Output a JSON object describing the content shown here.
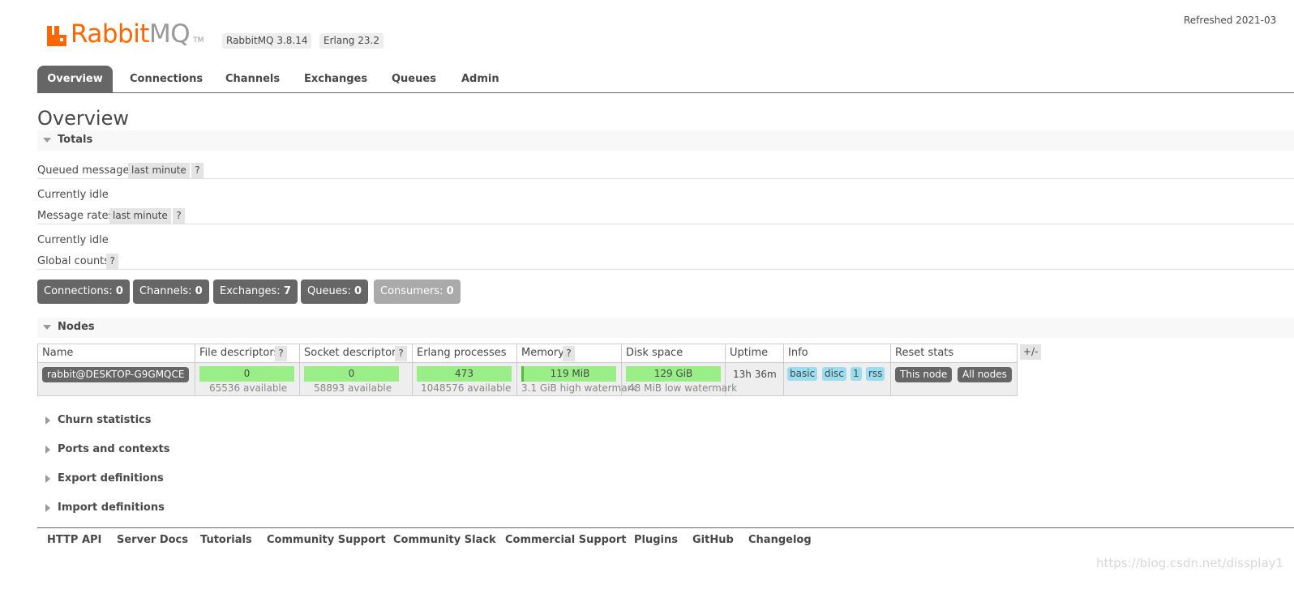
{
  "header": {
    "brand_rabbit": "Rabbit",
    "brand_mq": "MQ",
    "brand_tm": "TM",
    "rabbitmq_version": "RabbitMQ 3.8.14",
    "erlang_version": "Erlang 23.2",
    "refreshed": "Refreshed 2021-03",
    "brand_color": "#ff6600"
  },
  "tabs": [
    {
      "label": "Overview",
      "active": true
    },
    {
      "label": "Connections"
    },
    {
      "label": "Channels"
    },
    {
      "label": "Exchanges"
    },
    {
      "label": "Queues"
    },
    {
      "label": "Admin"
    }
  ],
  "page_title": "Overview",
  "totals": {
    "title": "Totals",
    "queued_messages_label": "Queued messages",
    "queued_messages_range": "last minute",
    "help": "?",
    "queued_idle": "Currently idle",
    "message_rates_label": "Message rates",
    "message_rates_range": "last minute",
    "rates_idle": "Currently idle",
    "global_counts_label": "Global counts"
  },
  "counts": {
    "connections_label": "Connections:",
    "connections_value": "0",
    "channels_label": "Channels:",
    "channels_value": "0",
    "exchanges_label": "Exchanges:",
    "exchanges_value": "7",
    "queues_label": "Queues:",
    "queues_value": "0",
    "consumers_label": "Consumers:",
    "consumers_value": "0"
  },
  "nodes": {
    "title": "Nodes",
    "columns": {
      "name": "Name",
      "file_descriptors": "File descriptors",
      "socket_descriptors": "Socket descriptors",
      "erlang_processes": "Erlang processes",
      "memory": "Memory",
      "disk_space": "Disk space",
      "uptime": "Uptime",
      "info": "Info",
      "reset_stats": "Reset stats"
    },
    "help": "?",
    "plus_minus": "+/-",
    "row": {
      "name": "rabbit@DESKTOP-G9GMQCE",
      "file_descriptors": "0",
      "file_descriptors_available": "65536 available",
      "socket_descriptors": "0",
      "socket_descriptors_available": "58893 available",
      "erlang_processes": "473",
      "erlang_processes_available": "1048576 available",
      "memory": "119 MiB",
      "memory_watermark": "3.1 GiB high watermark",
      "disk_space": "129 GiB",
      "disk_watermark": "48 MiB low watermark",
      "uptime": "13h 36m",
      "info_tags": [
        "basic",
        "disc",
        "1",
        "rss"
      ],
      "reset_this_node": "This node",
      "reset_all_nodes": "All nodes"
    }
  },
  "sections": {
    "churn": "Churn statistics",
    "ports": "Ports and contexts",
    "export": "Export definitions",
    "import": "Import definitions"
  },
  "footer": {
    "links": [
      "HTTP API",
      "Server Docs",
      "Tutorials",
      "Community Support",
      "Community Slack",
      "Commercial Support",
      "Plugins",
      "GitHub",
      "Changelog"
    ]
  },
  "watermark": "https://blog.csdn.net/dissplay1"
}
